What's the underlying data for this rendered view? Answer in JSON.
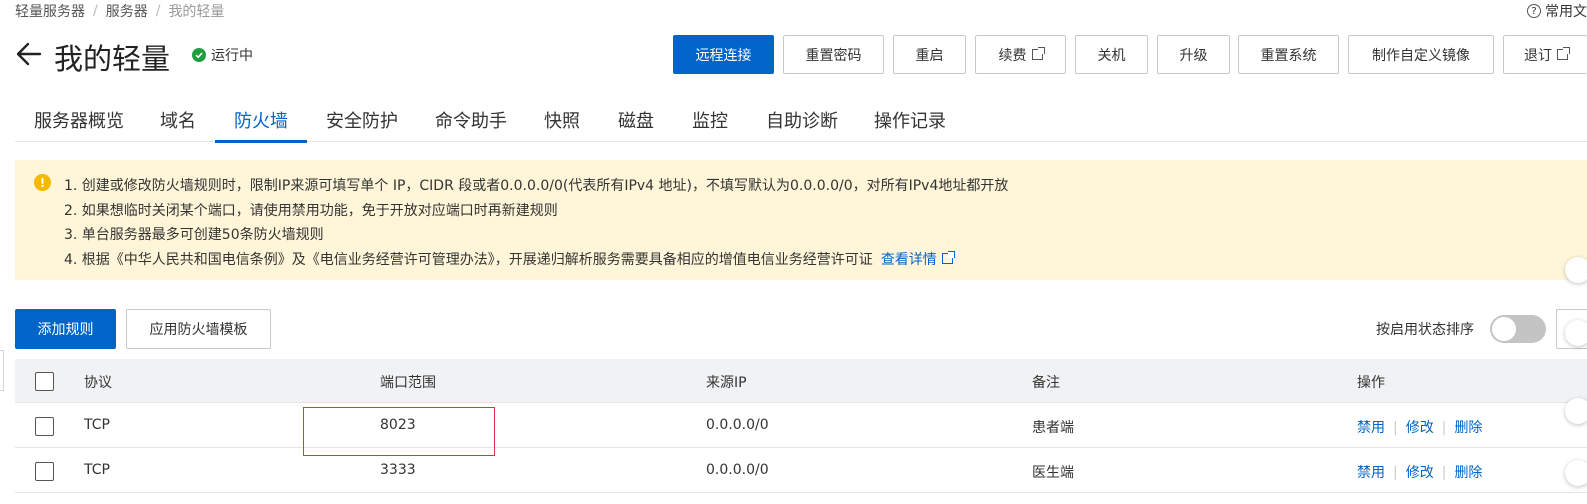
{
  "breadcrumb": {
    "items": [
      "轻量服务器",
      "服务器"
    ],
    "current": "我的轻量"
  },
  "help": {
    "icon": "question-circle-icon",
    "label": "常用文"
  },
  "header": {
    "back_icon": "arrow-left-icon",
    "title": "我的轻量",
    "status": "运行中",
    "status_color": "#1e9e3e"
  },
  "actions": {
    "remote": "远程连接",
    "reset_password": "重置密码",
    "restart": "重启",
    "renew": "续费",
    "shutdown": "关机",
    "upgrade": "升级",
    "reset_system": "重置系统",
    "custom_image": "制作自定义镜像",
    "refund": "退订"
  },
  "tabs": [
    "服务器概览",
    "域名",
    "防火墙",
    "安全防护",
    "命令助手",
    "快照",
    "磁盘",
    "监控",
    "自助诊断",
    "操作记录"
  ],
  "active_tab": "防火墙",
  "notice": {
    "lines": [
      "1. 创建或修改防火墙规则时，限制IP来源可填写单个 IP，CIDR 段或者0.0.0.0/0(代表所有IPv4 地址)，不填写默认为0.0.0.0/0，对所有IPv4地址都开放",
      "2. 如果想临时关闭某个端口，请使用禁用功能，免于开放对应端口时再新建规则",
      "3. 单台服务器最多可创建50条防火墙规则",
      "4. 根据《中华人民共和国电信条例》及《电信业务经营许可管理办法》，开展递归解析服务需要具备相应的增值电信业务经营许可证"
    ],
    "link": "查看详情",
    "bg_color": "#fff6d9"
  },
  "toolbar": {
    "add_rule": "添加规则",
    "apply_template": "应用防火墙模板",
    "sort_label": "按启用状态排序",
    "sort_enabled": false
  },
  "table": {
    "columns": [
      "协议",
      "端口范围",
      "来源IP",
      "备注",
      "操作"
    ],
    "rows": [
      {
        "protocol": "TCP",
        "port": "8023",
        "source": "0.0.0.0/0",
        "note": "患者端",
        "ops": [
          "禁用",
          "修改",
          "删除"
        ]
      },
      {
        "protocol": "TCP",
        "port": "3333",
        "source": "0.0.0.0/0",
        "note": "医生端",
        "ops": [
          "禁用",
          "修改",
          "删除"
        ]
      }
    ]
  },
  "colors": {
    "primary": "#0064c8",
    "highlight_border": "#d9363e"
  }
}
